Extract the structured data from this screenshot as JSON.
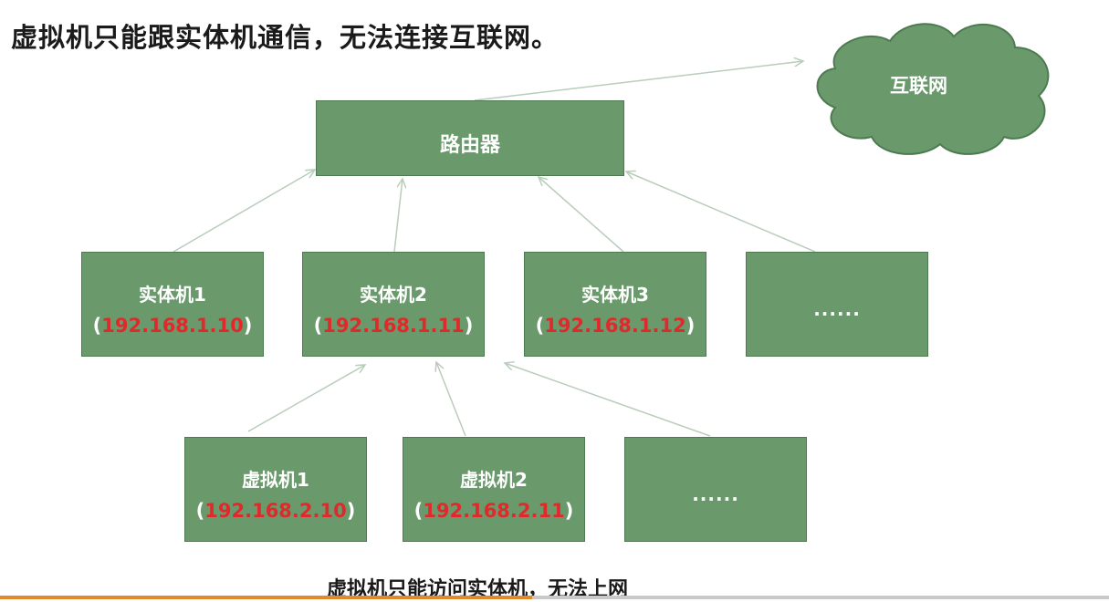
{
  "title": "虚拟机只能跟实体机通信，无法连接互联网。",
  "caption": "虚拟机只能访问实体机，无法上网",
  "internet": {
    "label": "互联网"
  },
  "router": {
    "label": "路由器"
  },
  "physical_hosts": [
    {
      "name": "实体机1",
      "open": "(",
      "ip": "192.168.1.10",
      "close": ")"
    },
    {
      "name": "实体机2",
      "open": "(",
      "ip": "192.168.1.11",
      "close": ")"
    },
    {
      "name": "实体机3",
      "open": "(",
      "ip": "192.168.1.12",
      "close": ")"
    },
    {
      "more": "......"
    }
  ],
  "virtual_machines": [
    {
      "name": "虚拟机1",
      "open": "(",
      "ip": "192.168.2.10",
      "close": ")"
    },
    {
      "name": "虚拟机2",
      "open": "(",
      "ip": "192.168.2.11",
      "close": ")"
    },
    {
      "more": "......"
    }
  ],
  "colors": {
    "box_fill": "#6a9a6c",
    "box_border": "#4d7a50",
    "ip_text": "#e0292b",
    "arrow": "#b9cdbb",
    "accent_bar": "#e28a2b"
  }
}
